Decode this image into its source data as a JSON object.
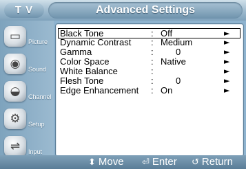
{
  "header": {
    "tv_label": "T V",
    "title": "Advanced Settings"
  },
  "sidebar": {
    "items": [
      {
        "label": "Picture",
        "icon": "picture-icon"
      },
      {
        "label": "Sound",
        "icon": "sound-icon"
      },
      {
        "label": "Channel",
        "icon": "channel-icon"
      },
      {
        "label": "Setup",
        "icon": "setup-icon"
      },
      {
        "label": "Input",
        "icon": "input-icon"
      }
    ]
  },
  "settings": {
    "rows": [
      {
        "label": "Black Tone",
        "value": "Off",
        "arrow": "►",
        "selected": true
      },
      {
        "label": "Dynamic Contrast",
        "value": "Medium",
        "arrow": "►"
      },
      {
        "label": "Gamma",
        "value": "0",
        "arrow": "►"
      },
      {
        "label": "Color Space",
        "value": "Native",
        "arrow": "►"
      },
      {
        "label": "White Balance",
        "value": "",
        "arrow": "►"
      },
      {
        "label": "Flesh Tone",
        "value": "0",
        "arrow": "►"
      },
      {
        "label": "Edge Enhancement",
        "value": "On",
        "arrow": "►"
      }
    ],
    "colon": ":"
  },
  "footer": {
    "move_label": "Move",
    "enter_label": "Enter",
    "return_label": "Return"
  },
  "colors": {
    "background": "#8eb3cf",
    "panel": "#ffffff",
    "text": "#000000"
  }
}
